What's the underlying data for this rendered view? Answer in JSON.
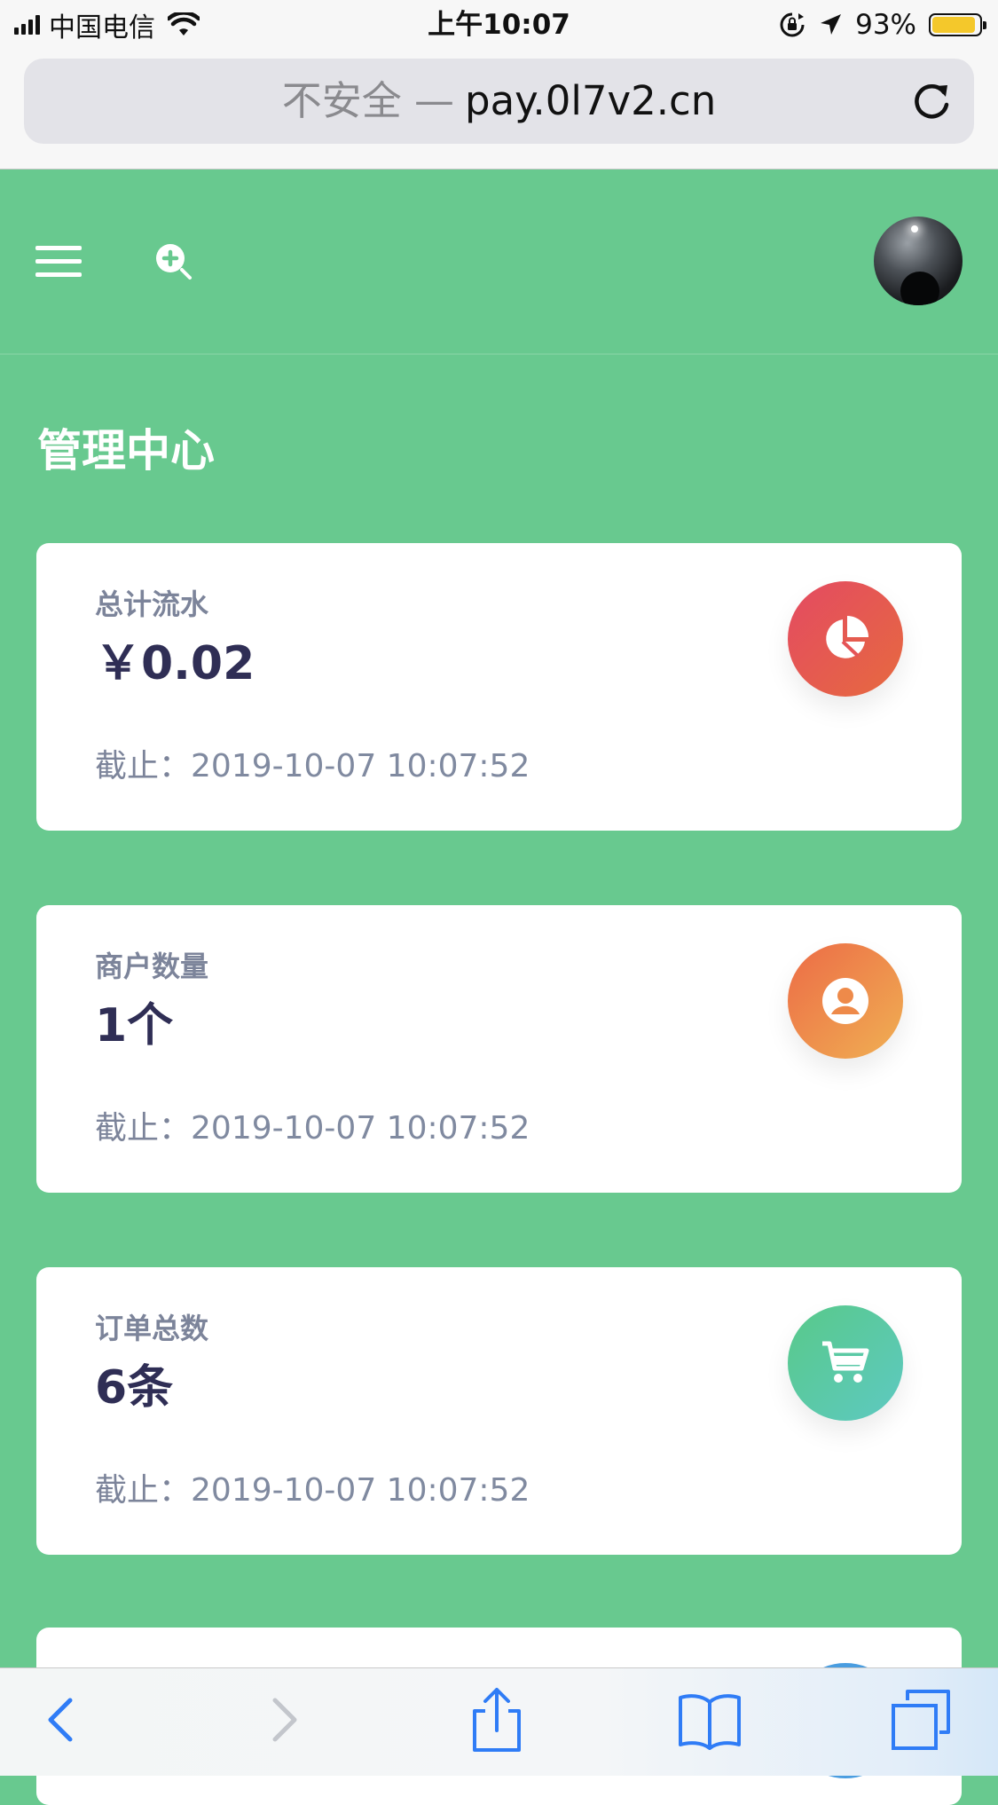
{
  "status_bar": {
    "carrier": "中国电信",
    "time": "上午10:07",
    "battery_percent": "93%",
    "battery_level": 0.93,
    "battery_color": "#f4c82b"
  },
  "browser": {
    "security_label": "不安全 —",
    "domain": "pay.0l7v2.cn"
  },
  "header": {
    "menu_icon": "hamburger-menu-icon",
    "search_icon": "search-plus-icon",
    "avatar": "user-avatar-photo"
  },
  "page": {
    "title": "管理中心"
  },
  "cards": [
    {
      "label": "总计流水",
      "value": "￥0.02",
      "date_label": "截止：",
      "date_value": "2019-10-07 10:07:52",
      "icon": "pie-chart-icon",
      "icon_gradient": [
        "#e44a62",
        "#e66a3f"
      ]
    },
    {
      "label": "商户数量",
      "value": "1个",
      "date_label": "截止：",
      "date_value": "2019-10-07 10:07:52",
      "icon": "user-circle-icon",
      "icon_gradient": [
        "#ec6b46",
        "#f0b053"
      ]
    },
    {
      "label": "订单总数",
      "value": "6条",
      "date_label": "截止：",
      "date_value": "2019-10-07 10:07:52",
      "icon": "shopping-cart-icon",
      "icon_gradient": [
        "#58c989",
        "#5ec9c2"
      ]
    }
  ],
  "toolbar": {
    "back": "back-chevron-icon",
    "forward": "forward-chevron-icon",
    "share": "share-icon",
    "bookmarks": "bookmarks-book-icon",
    "tabs": "tabs-icon",
    "accent_color": "#2f7cf6"
  },
  "colors": {
    "page_background": "#68c98f",
    "value_text": "#2f2e55",
    "label_text": "#7c849a"
  }
}
